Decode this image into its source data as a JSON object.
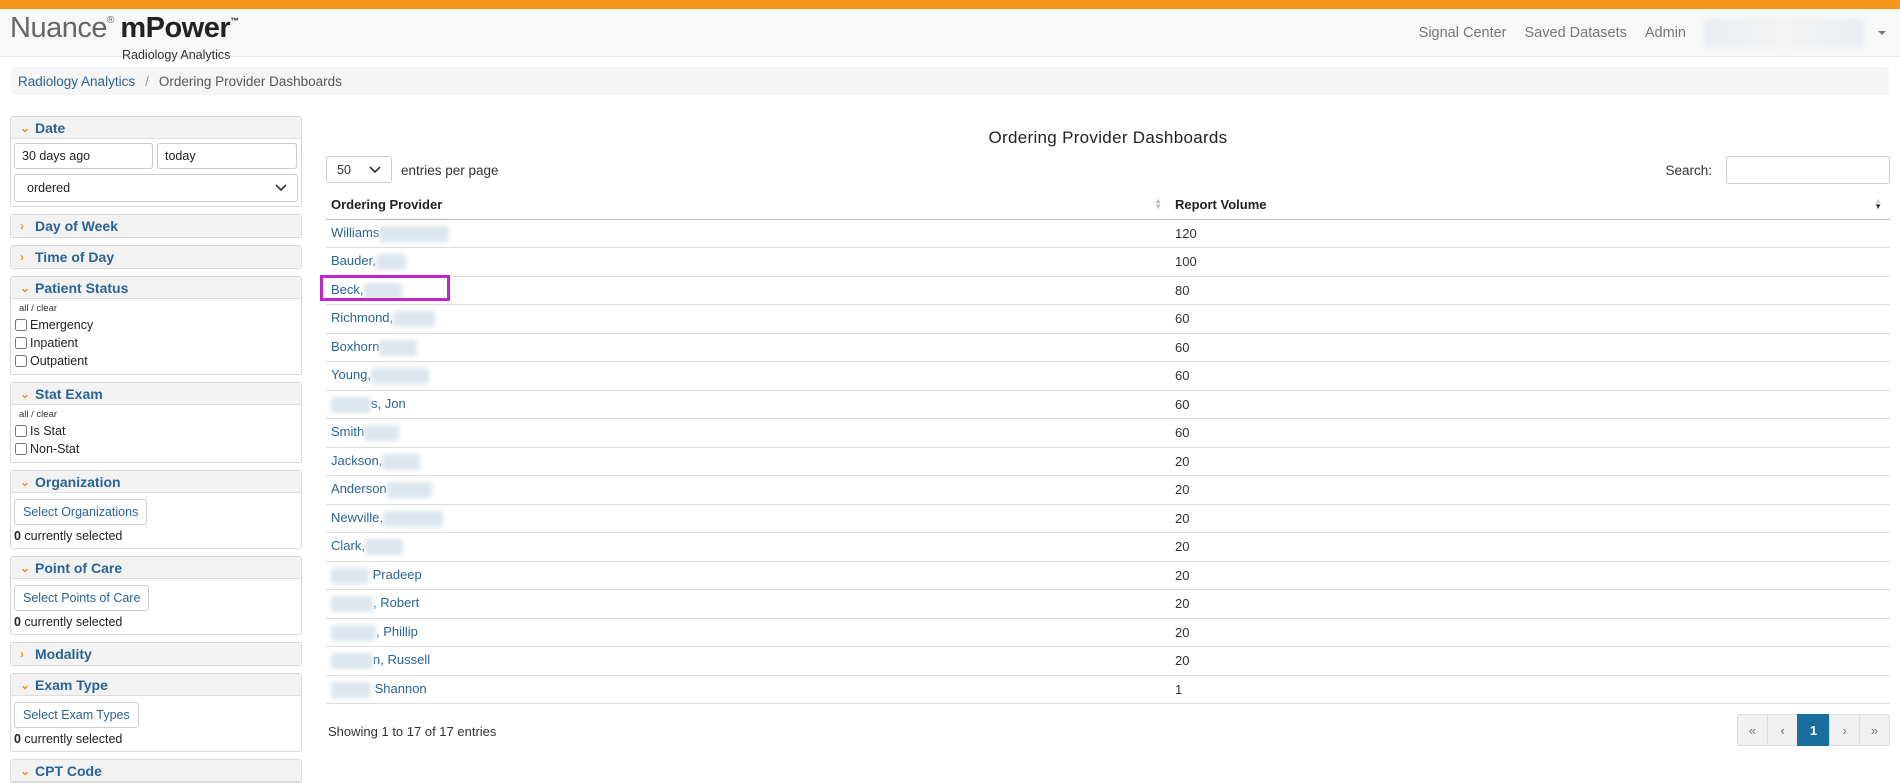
{
  "brand": {
    "name": "Nuance",
    "reg": "®",
    "product": "mPower",
    "tm": "™",
    "subtitle": "Radiology Analytics"
  },
  "nav": {
    "links": [
      "Signal Center",
      "Saved Datasets",
      "Admin"
    ]
  },
  "breadcrumb": {
    "root": "Radiology Analytics",
    "separator": "/",
    "current": "Ordering Provider Dashboards"
  },
  "sidebar": {
    "date": {
      "title": "Date",
      "from": "30 days ago",
      "to": "today",
      "mode": "ordered"
    },
    "day_of_week": {
      "title": "Day of Week"
    },
    "time_of_day": {
      "title": "Time of Day"
    },
    "patient_status": {
      "title": "Patient Status",
      "all_clear": "all / clear",
      "options": [
        "Emergency",
        "Inpatient",
        "Outpatient"
      ]
    },
    "stat_exam": {
      "title": "Stat Exam",
      "all_clear": "all / clear",
      "options": [
        "Is Stat",
        "Non-Stat"
      ]
    },
    "organization": {
      "title": "Organization",
      "button": "Select Organizations",
      "count": "0",
      "count_label": " currently selected"
    },
    "point_of_care": {
      "title": "Point of Care",
      "button": "Select Points of Care",
      "count": "0",
      "count_label": " currently selected"
    },
    "modality": {
      "title": "Modality"
    },
    "exam_type": {
      "title": "Exam Type",
      "button": "Select Exam Types",
      "count": "0",
      "count_label": " currently selected"
    },
    "cpt_code": {
      "title": "CPT Code"
    }
  },
  "main": {
    "title": "Ordering Provider Dashboards",
    "page_length": "50",
    "page_length_label": "entries per page",
    "search_label": "Search:",
    "columns": [
      "Ordering Provider",
      "Report Volume"
    ],
    "rows": [
      {
        "pre": "",
        "name": "Williams",
        "post": "",
        "volume": "120"
      },
      {
        "pre": "",
        "name": "Bauder,",
        "post": "",
        "volume": "100"
      },
      {
        "pre": "",
        "name": "Beck,",
        "post": "",
        "volume": "80"
      },
      {
        "pre": "",
        "name": "Richmond,",
        "post": "",
        "volume": "60"
      },
      {
        "pre": "",
        "name": "Boxhorn",
        "post": "",
        "volume": "60"
      },
      {
        "pre": "",
        "name": "Young,",
        "post": "",
        "volume": "60"
      },
      {
        "pre": "",
        "name": "",
        "post": "s, Jon",
        "volume": "60"
      },
      {
        "pre": "",
        "name": "Smith",
        "post": "",
        "volume": "60"
      },
      {
        "pre": "",
        "name": "Jackson,",
        "post": "",
        "volume": "20"
      },
      {
        "pre": "",
        "name": "Anderson",
        "post": "",
        "volume": "20"
      },
      {
        "pre": "",
        "name": "Newville,",
        "post": "",
        "volume": "20"
      },
      {
        "pre": "",
        "name": "Clark,",
        "post": "",
        "volume": "20"
      },
      {
        "pre": "",
        "name": "",
        "post": " Pradeep",
        "volume": "20"
      },
      {
        "pre": "",
        "name": "",
        "post": ", Robert",
        "volume": "20"
      },
      {
        "pre": "",
        "name": "",
        "post": ", Phillip",
        "volume": "20"
      },
      {
        "pre": "",
        "name": "",
        "post": "n, Russell",
        "volume": "20"
      },
      {
        "pre": "",
        "name": "",
        "post": " Shannon",
        "volume": "1"
      }
    ],
    "info": "Showing 1 to 17 of 17 entries",
    "pager": [
      "«",
      "‹",
      "1",
      "›",
      "»"
    ],
    "highlight_color": "#c026c5"
  },
  "colors": {
    "accent": "#f7941d",
    "link": "#2a6496",
    "active_page": "#1a6e9e"
  }
}
